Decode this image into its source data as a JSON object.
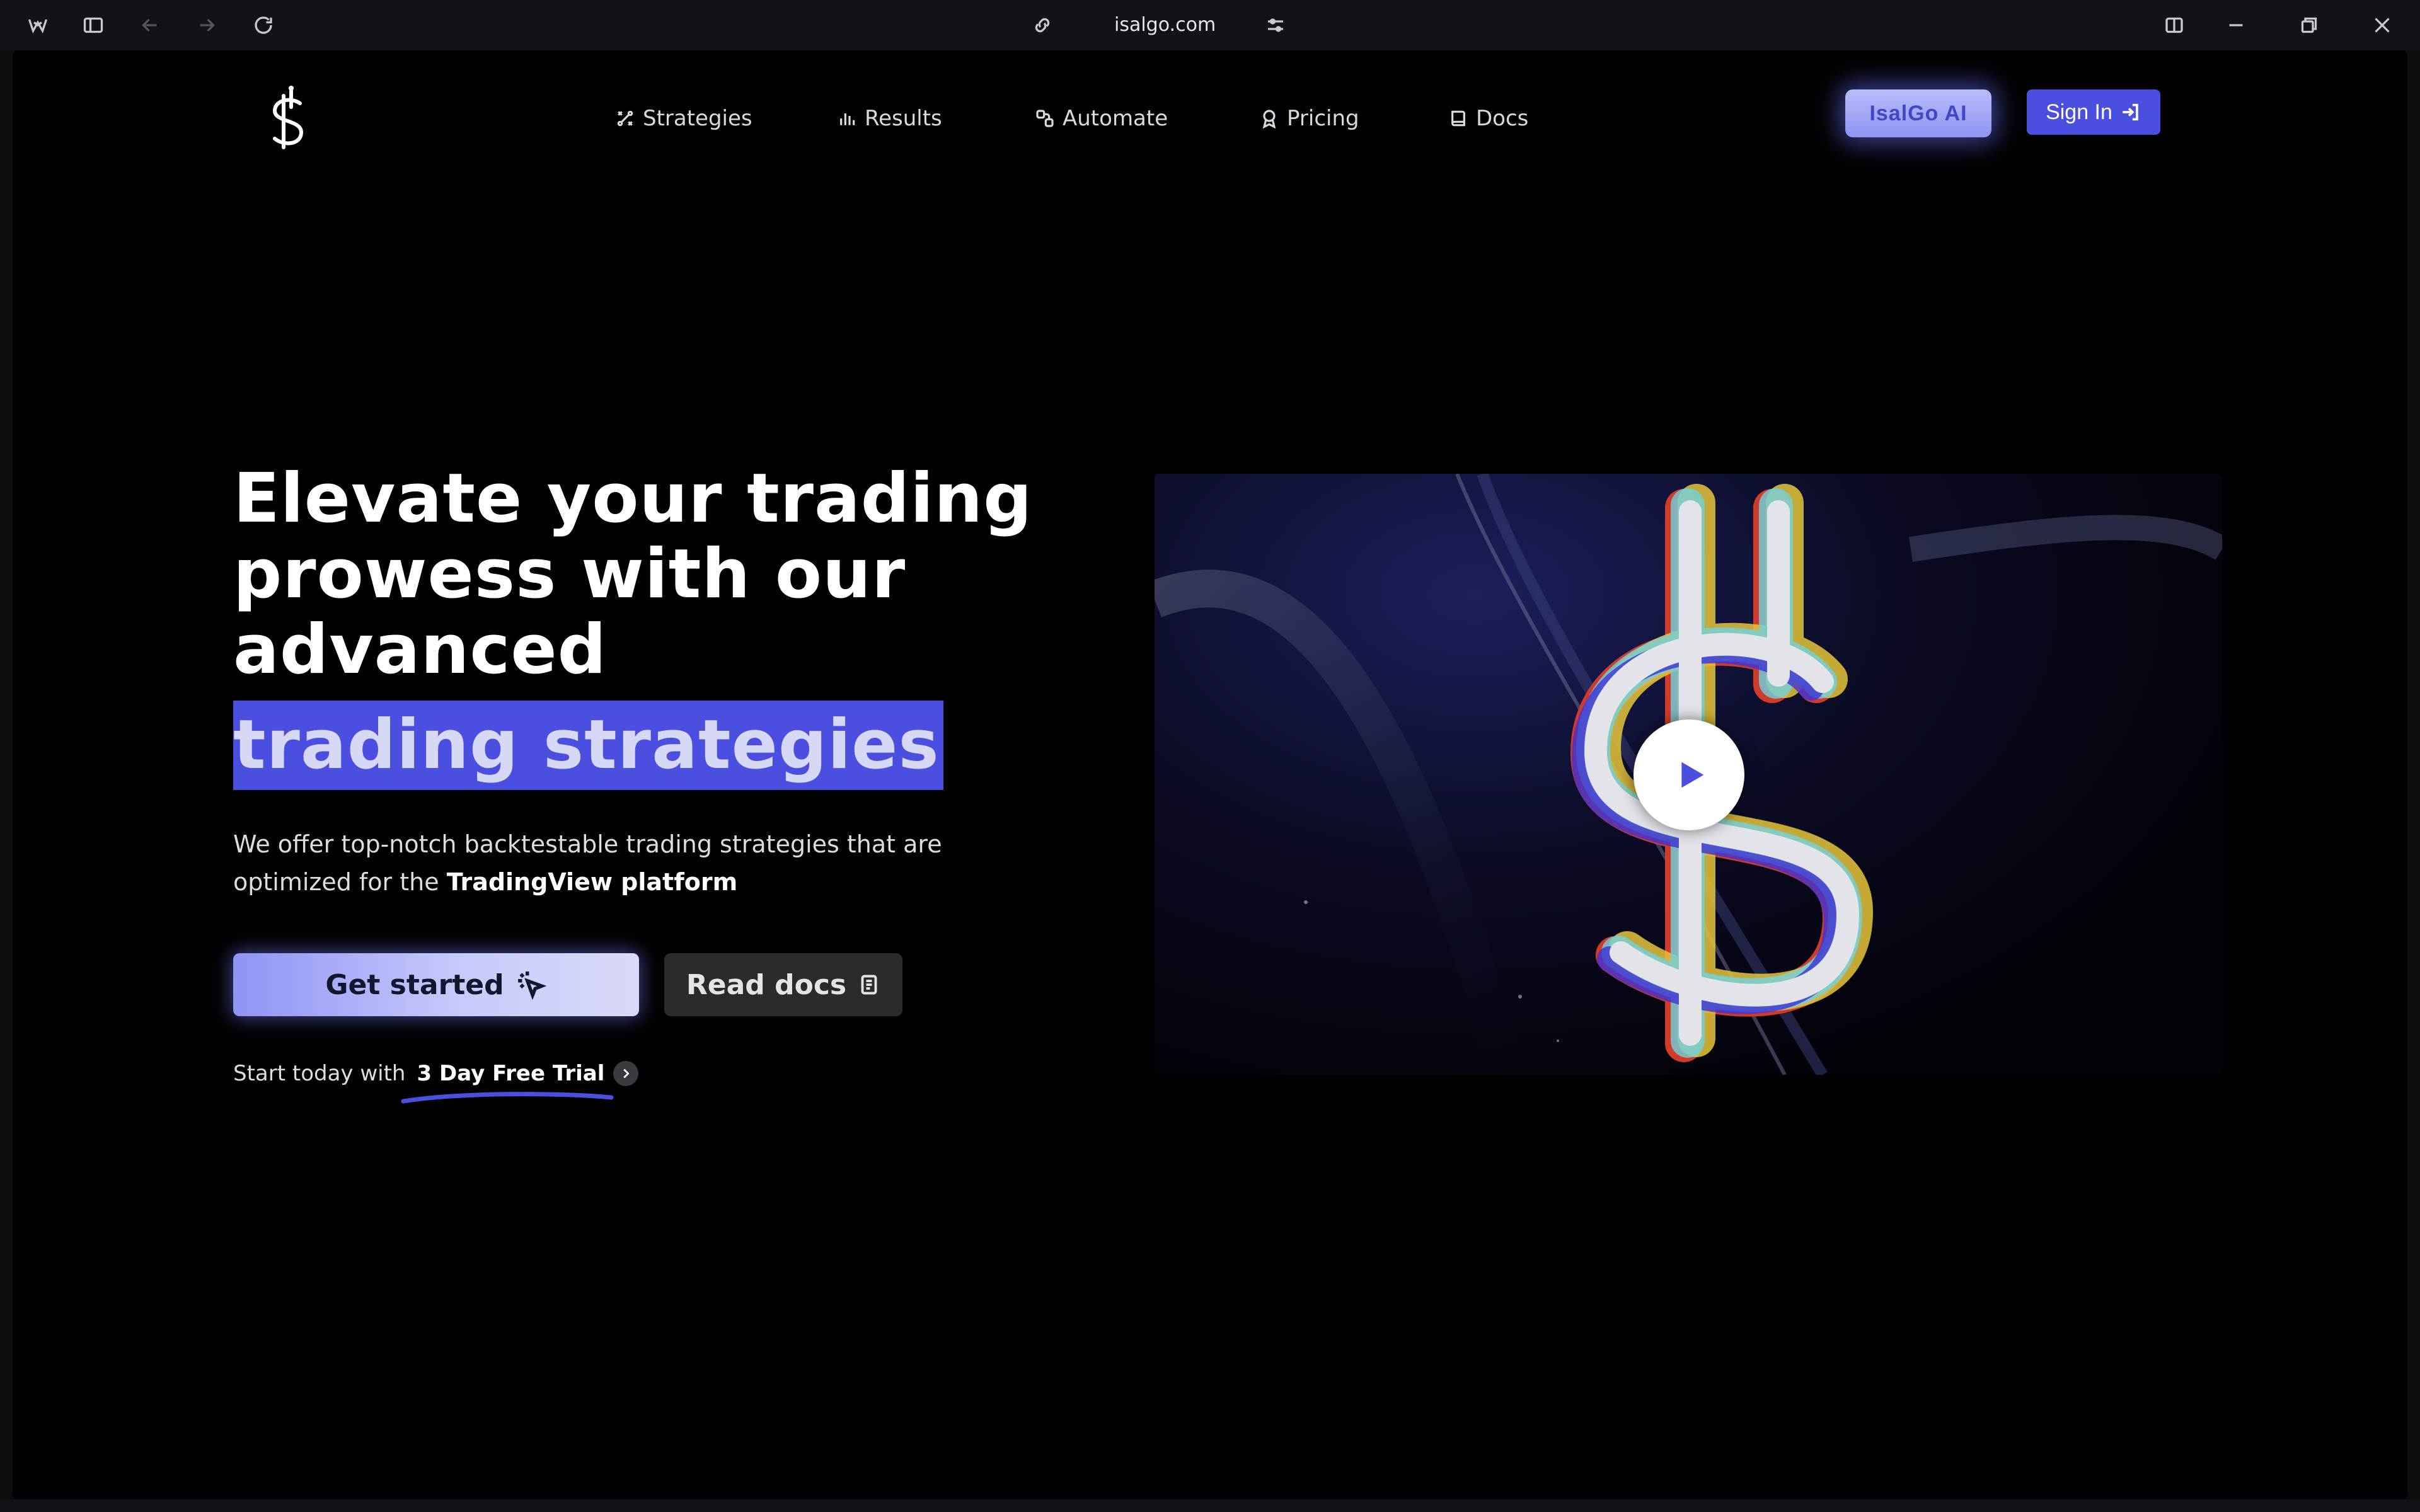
{
  "browser": {
    "url": "isalgo.com"
  },
  "nav": {
    "items": [
      {
        "label": "Strategies",
        "icon": "strategies-icon"
      },
      {
        "label": "Results",
        "icon": "bar-chart-icon"
      },
      {
        "label": "Automate",
        "icon": "automate-icon"
      },
      {
        "label": "Pricing",
        "icon": "award-icon"
      },
      {
        "label": "Docs",
        "icon": "book-icon"
      }
    ],
    "ai_button": "IsalGo AI",
    "signin_button": "Sign In"
  },
  "hero": {
    "headline_lines": [
      "Elevate your trading",
      "prowess with our",
      "advanced"
    ],
    "highlight": "trading strategies",
    "sub_prefix": "We offer top-notch backtestable trading strategies that are optimized for the ",
    "sub_bold": "TradingView platform",
    "get_started": "Get started",
    "read_docs": "Read docs",
    "trial_prefix": "Start today with",
    "trial_bold": "3 Day Free Trial"
  },
  "colors": {
    "accent": "#4a4fe0",
    "page_bg": "#000000",
    "chrome_bg": "#121318"
  }
}
